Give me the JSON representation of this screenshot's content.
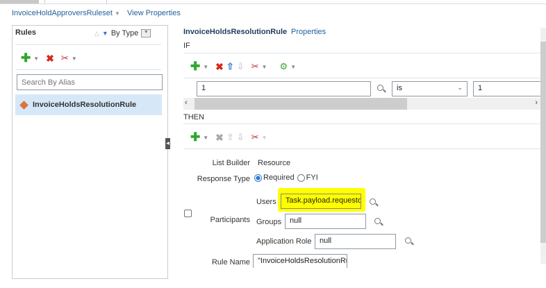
{
  "header": {
    "ruleset": "InvoiceHoldApproversRuleset",
    "view_properties": "View Properties"
  },
  "rules_panel": {
    "title": "Rules",
    "sort_label": "By Type",
    "search_placeholder": "Search By Alias",
    "rules": [
      {
        "label": "InvoiceHoldsResolutionRule",
        "selected": true
      }
    ]
  },
  "rule": {
    "name": "InvoiceHoldsResolutionRule",
    "properties": "Properties",
    "if_label": "IF",
    "then_label": "THEN",
    "condition": {
      "left": "1",
      "operator": "is",
      "right": "1"
    },
    "action": {
      "list_builder_label": "List Builder",
      "list_builder": "Resource",
      "response_type_label": "Response Type",
      "response_options": [
        "Required",
        "FYI"
      ],
      "response_selected": "Required",
      "participants_label": "Participants",
      "users_label": "Users",
      "users": "Task.payload.requestor",
      "groups_label": "Groups",
      "groups": "null",
      "app_role_label": "Application Role",
      "app_role": "null",
      "rule_name_label": "Rule Name",
      "rule_name": "\"InvoiceHoldsResolutionRul"
    }
  },
  "colors": {
    "highlight": "#ffff00",
    "selected_row": "#d6e8f8",
    "link": "#1f5f9c"
  }
}
